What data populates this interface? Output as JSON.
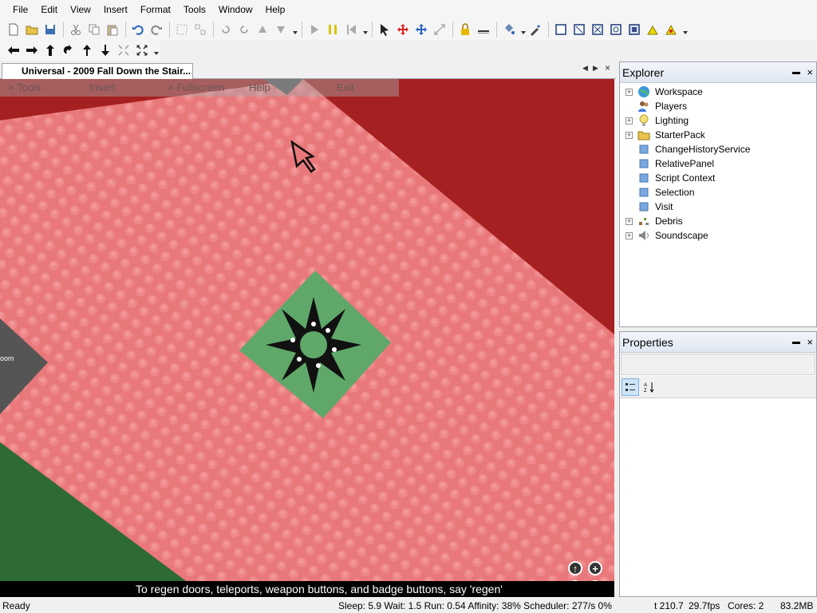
{
  "menu": [
    "File",
    "Edit",
    "View",
    "Insert",
    "Format",
    "Tools",
    "Window",
    "Help"
  ],
  "toolbar1": {
    "icons": [
      "new-icon",
      "open-icon",
      "save-icon",
      "cut-icon",
      "copy-icon",
      "paste-icon",
      "undo-icon",
      "redo-icon",
      "group-icon",
      "ungroup-icon",
      "rotate-left-icon",
      "rotate-right-icon",
      "tilt-up-icon",
      "tilt-down-icon",
      "play-icon",
      "pause-icon",
      "stop-icon",
      "select-icon",
      "move-icon",
      "drag-icon",
      "resize-icon",
      "lock-icon",
      "anchor-icon",
      "fill-icon",
      "dropper-icon",
      "box-icon",
      "weld-icon",
      "glue-icon",
      "stud-icon",
      "inlet-icon",
      "hinge-icon",
      "motor-icon"
    ]
  },
  "document": {
    "tab_title": "Universal - 2009 Fall Down the Stair..."
  },
  "game": {
    "topbar": {
      "tools": "× Tools",
      "insert": "Insert",
      "fullscreen": "× Fullscreen",
      "help": "Help",
      "exit": "Exit"
    },
    "side_label": "oom",
    "hint": "To regen doors, teleports, weapon buttons, and badge buttons, say 'regen'",
    "camera": {
      "up": "↑",
      "zoom_in": "+",
      "down": "↓",
      "zoom_out": "−"
    }
  },
  "explorer": {
    "title": "Explorer",
    "pin": "📌",
    "close": "×",
    "items": [
      {
        "label": "Workspace",
        "icon": "globe-icon",
        "expandable": true
      },
      {
        "label": "Players",
        "icon": "players-icon",
        "expandable": false
      },
      {
        "label": "Lighting",
        "icon": "lightbulb-icon",
        "expandable": true
      },
      {
        "label": "StarterPack",
        "icon": "folder-icon",
        "expandable": true
      },
      {
        "label": "ChangeHistoryService",
        "icon": "service-icon",
        "expandable": false
      },
      {
        "label": "RelativePanel",
        "icon": "service-icon",
        "expandable": false
      },
      {
        "label": "Script Context",
        "icon": "service-icon",
        "expandable": false
      },
      {
        "label": "Selection",
        "icon": "service-icon",
        "expandable": false
      },
      {
        "label": "Visit",
        "icon": "service-icon",
        "expandable": false
      },
      {
        "label": "Debris",
        "icon": "debris-icon",
        "expandable": true
      },
      {
        "label": "Soundscape",
        "icon": "speaker-icon",
        "expandable": true
      }
    ]
  },
  "properties": {
    "title": "Properties"
  },
  "status": {
    "left": "Ready",
    "stats": "Sleep: 5.9 Wait: 1.5 Run: 0.54 Affinity: 38% Scheduler: 277/s 0%",
    "time": "t 210.7",
    "fps": "29.7fps",
    "cores": "Cores: 2",
    "memory": "83.2MB"
  },
  "colors": {
    "baseplate": "#e8787a",
    "background_red": "#a52020",
    "green_pad": "#5fa86a",
    "dark_green": "#2e6a36"
  }
}
